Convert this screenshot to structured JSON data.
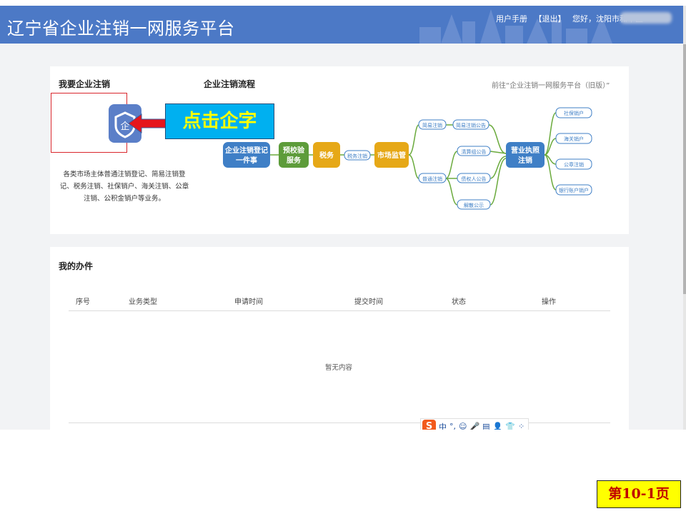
{
  "header": {
    "title": "辽宁省企业注销一网服务平台",
    "user_manual": "用户手册",
    "logout": "【退出】",
    "greeting": "您好，沈阳市和平区",
    "bg_color": "#4c79c6"
  },
  "cancel_section": {
    "title": "我要企业注销",
    "flow_title": "企业注销流程",
    "goto_old": "前往“企业注销一网服务平台（旧版）”",
    "description": "各类市场主体普通注销登记、简易注销登记、税务注销、社保销户、海关注销、公章注销、公积金销户等业务。",
    "callout": "点击企字",
    "icon": "enterprise-shield-icon"
  },
  "flow": {
    "one_thing": "企业注销登记一件事",
    "precheck": "预校验服务",
    "tax": "税务",
    "tax_cancel": "税务注销",
    "market": "市场监管",
    "simple_cancel": "简易注销",
    "simple_notice": "简易注销公告",
    "normal_cancel": "普通注销",
    "liquidation_team": "清算组公告",
    "creditor_notice": "债权人公告",
    "dissolution_notice": "解散公示",
    "license_cancel": "营业执照注销",
    "social_security": "社保销户",
    "customs": "海关销户",
    "seal_cancel": "公章注销",
    "bank": "银行账户销户",
    "colors": {
      "blue": "#3f7fc6",
      "green": "#5d9c3a",
      "gold": "#e6a817",
      "line": "#6aaa3c",
      "small_border": "#3f7fc6"
    }
  },
  "my_work": {
    "title": "我的办件",
    "columns": [
      "序号",
      "业务类型",
      "申请时间",
      "提交时间",
      "状态",
      "操作"
    ],
    "empty_text": "暂无内容"
  },
  "ime_toolbar": {
    "logo": "S",
    "items": [
      "中",
      "°,",
      "☺",
      "🎤",
      "▤",
      "👤",
      "👕",
      "⁘"
    ]
  },
  "page_label": "第10-1页"
}
